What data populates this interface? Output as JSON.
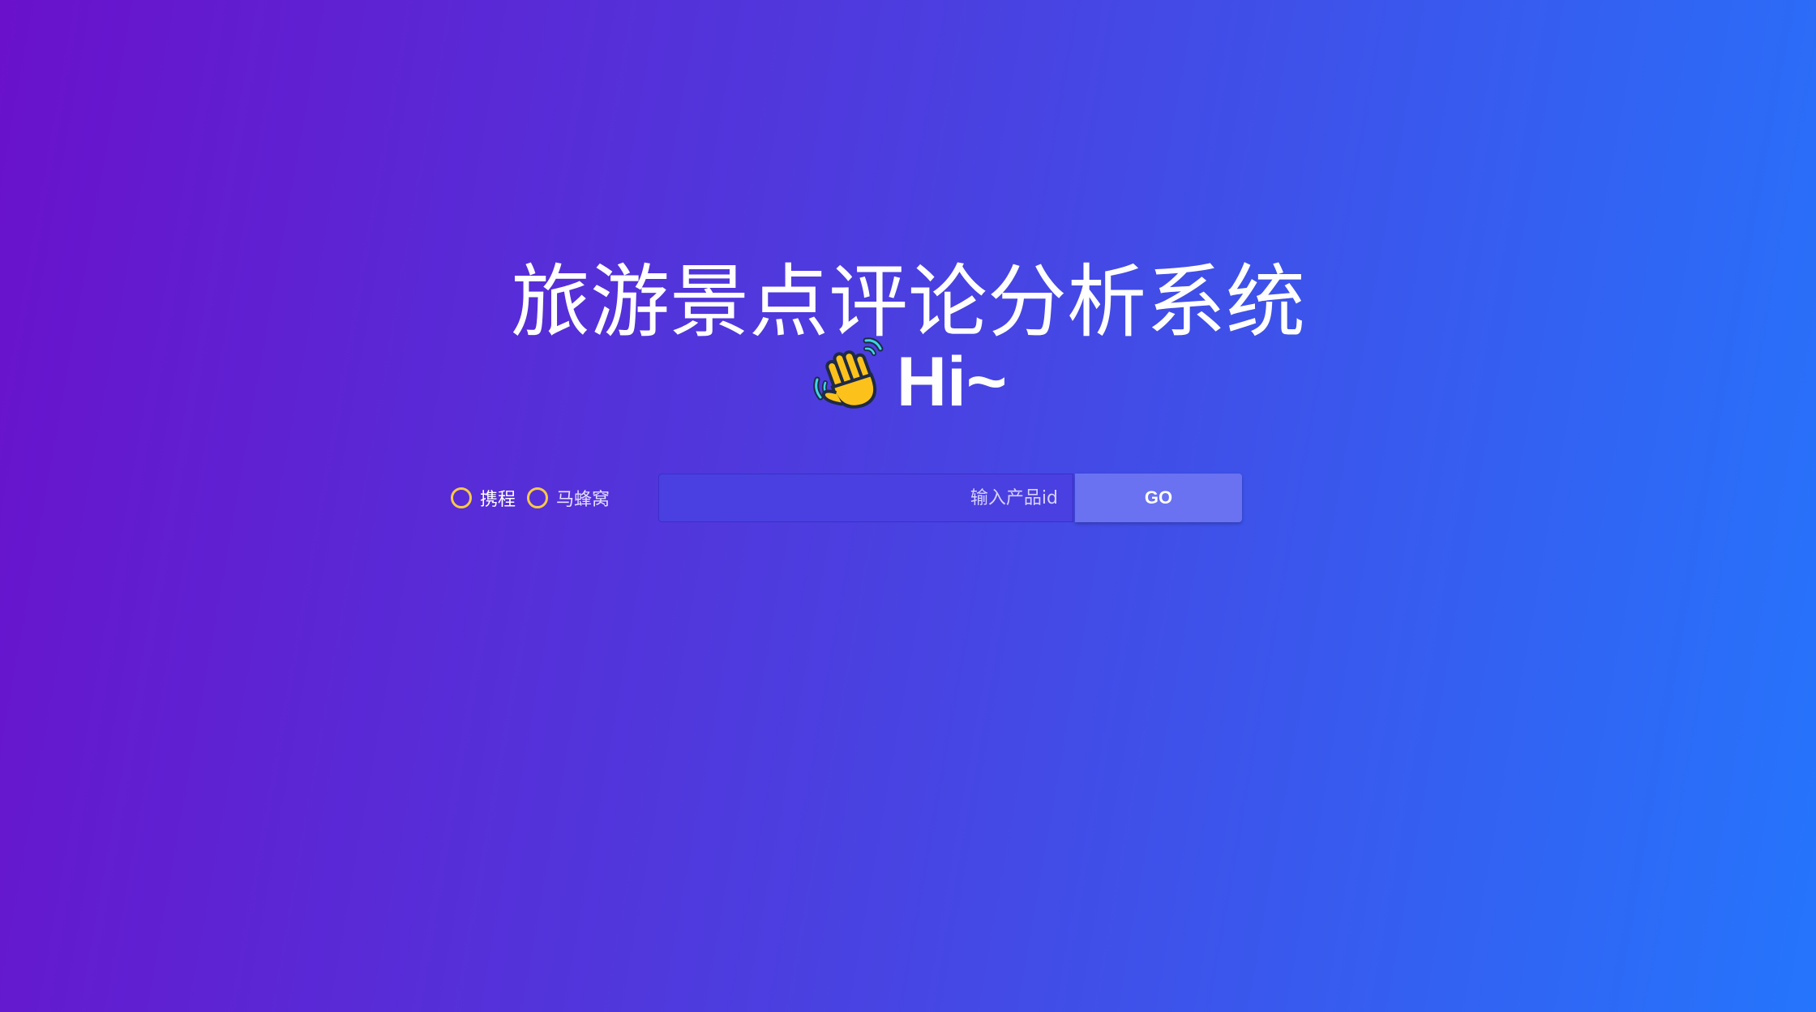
{
  "header": {
    "title": "旅游景点评论分析系统",
    "greeting_icon": "waving-hand-icon",
    "greeting": "Hi~"
  },
  "search": {
    "options": [
      {
        "label": "携程",
        "selected": false
      },
      {
        "label": "马蜂窝",
        "selected": false
      }
    ],
    "placeholder": "输入产品id",
    "value": "",
    "go_label": "GO"
  },
  "colors": {
    "gradient_start": "#6a11cb",
    "gradient_end": "#2575fc",
    "radio_ring": "#f7c948",
    "button": "#6a72f2"
  }
}
